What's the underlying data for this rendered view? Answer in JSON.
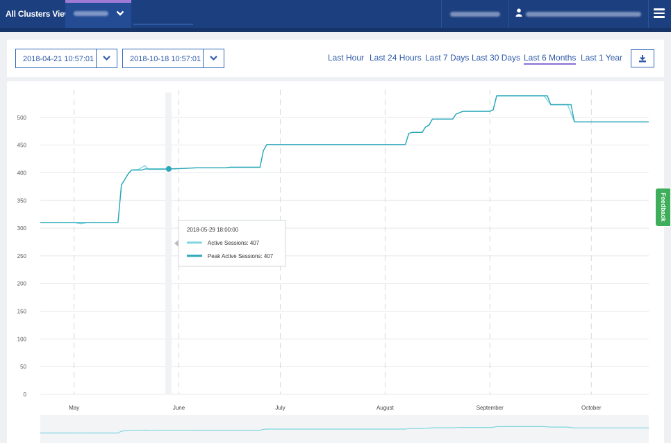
{
  "header": {
    "title": "All Clusters View",
    "cluster_name": "",
    "org_name": "",
    "user_email": ""
  },
  "toolbar": {
    "start_date": "2018-04-21 10:57:01",
    "end_date": "2018-10-18 10:57:01",
    "ranges": [
      "Last Hour",
      "Last 24 Hours",
      "Last 7 Days",
      "Last 30 Days",
      "Last 6 Months",
      "Last 1 Year"
    ],
    "active_range": "Last 6 Months"
  },
  "feedback_label": "Feedback",
  "colors": {
    "active": "#7fd6df",
    "peak": "#2aa7b8",
    "header": "#1c3f7f",
    "link": "#2e5aa8",
    "accent": "#8b6fd6"
  },
  "chart_data": {
    "type": "line",
    "title": "",
    "xlabel": "",
    "ylabel": "",
    "ylim": [
      0,
      550
    ],
    "yticks": [
      0,
      50,
      100,
      150,
      200,
      250,
      300,
      350,
      400,
      450,
      500
    ],
    "xlim": [
      "2018-04-21",
      "2018-10-18"
    ],
    "xticks": [
      {
        "label": "May",
        "date": "2018-05-01"
      },
      {
        "label": "June",
        "date": "2018-06-01"
      },
      {
        "label": "July",
        "date": "2018-07-01"
      },
      {
        "label": "August",
        "date": "2018-08-01"
      },
      {
        "label": "September",
        "date": "2018-09-01"
      },
      {
        "label": "October",
        "date": "2018-10-01"
      }
    ],
    "grid": true,
    "series": [
      {
        "name": "Active Sessions",
        "values": [
          [
            "2018-04-21",
            310
          ],
          [
            "2018-05-01",
            310
          ],
          [
            "2018-05-03",
            308
          ],
          [
            "2018-05-05",
            310
          ],
          [
            "2018-05-14",
            310
          ],
          [
            "2018-05-15",
            378
          ],
          [
            "2018-05-17",
            398
          ],
          [
            "2018-05-18",
            405
          ],
          [
            "2018-05-20",
            406
          ],
          [
            "2018-05-22",
            413
          ],
          [
            "2018-05-23",
            406
          ],
          [
            "2018-05-27",
            406
          ],
          [
            "2018-05-29",
            407
          ],
          [
            "2018-06-03",
            408
          ],
          [
            "2018-06-06",
            409
          ],
          [
            "2018-06-15",
            409
          ],
          [
            "2018-06-16",
            410
          ],
          [
            "2018-06-25",
            410
          ],
          [
            "2018-06-26",
            440
          ],
          [
            "2018-06-27",
            451
          ],
          [
            "2018-08-07",
            451
          ],
          [
            "2018-08-08",
            471
          ],
          [
            "2018-08-09",
            473
          ],
          [
            "2018-08-12",
            473
          ],
          [
            "2018-08-13",
            483
          ],
          [
            "2018-08-14",
            486
          ],
          [
            "2018-08-15",
            497
          ],
          [
            "2018-08-21",
            497
          ],
          [
            "2018-08-22",
            506
          ],
          [
            "2018-08-24",
            511
          ],
          [
            "2018-09-01",
            511
          ],
          [
            "2018-09-02",
            514
          ],
          [
            "2018-09-03",
            539
          ],
          [
            "2018-09-17",
            539
          ],
          [
            "2018-09-19",
            523
          ],
          [
            "2018-09-24",
            523
          ],
          [
            "2018-09-26",
            492
          ],
          [
            "2018-10-18",
            492
          ]
        ]
      },
      {
        "name": "Peak Active Sessions",
        "values": [
          [
            "2018-04-21",
            310
          ],
          [
            "2018-05-14",
            310
          ],
          [
            "2018-05-15",
            378
          ],
          [
            "2018-05-17",
            398
          ],
          [
            "2018-05-18",
            405
          ],
          [
            "2018-05-21",
            405
          ],
          [
            "2018-05-22",
            407
          ],
          [
            "2018-05-29",
            407
          ],
          [
            "2018-06-03",
            408
          ],
          [
            "2018-06-06",
            409
          ],
          [
            "2018-06-15",
            409
          ],
          [
            "2018-06-16",
            410
          ],
          [
            "2018-06-25",
            410
          ],
          [
            "2018-06-26",
            440
          ],
          [
            "2018-06-27",
            451
          ],
          [
            "2018-08-07",
            451
          ],
          [
            "2018-08-08",
            471
          ],
          [
            "2018-08-09",
            473
          ],
          [
            "2018-08-12",
            473
          ],
          [
            "2018-08-13",
            483
          ],
          [
            "2018-08-14",
            486
          ],
          [
            "2018-08-15",
            497
          ],
          [
            "2018-08-21",
            497
          ],
          [
            "2018-08-22",
            506
          ],
          [
            "2018-08-24",
            511
          ],
          [
            "2018-09-01",
            511
          ],
          [
            "2018-09-02",
            514
          ],
          [
            "2018-09-03",
            539
          ],
          [
            "2018-09-18",
            539
          ],
          [
            "2018-09-19",
            523
          ],
          [
            "2018-09-25",
            523
          ],
          [
            "2018-09-26",
            492
          ],
          [
            "2018-10-18",
            492
          ]
        ]
      }
    ],
    "tooltip": {
      "date": "2018-05-29 18:00:00",
      "lines": [
        "Active Sessions: 407",
        "Peak Active Sessions: 407"
      ],
      "value": 407
    }
  }
}
